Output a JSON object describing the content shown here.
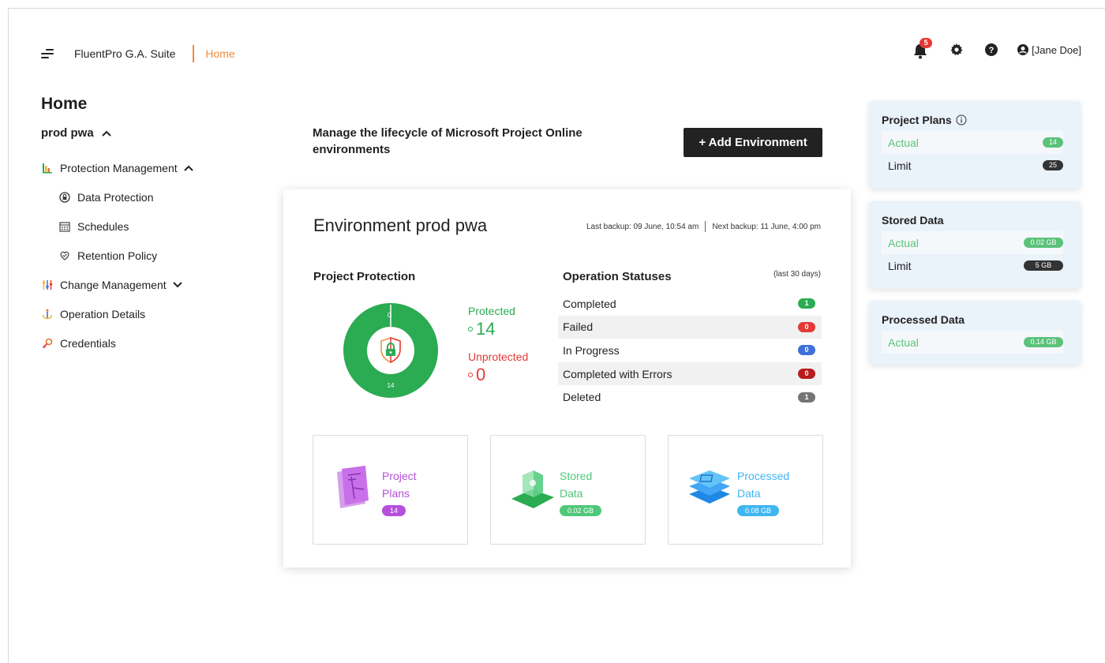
{
  "header": {
    "brand": "FluentPro G.A. Suite",
    "breadcrumb": "Home",
    "notifications_count": "5",
    "user_name": "[Jane Doe]"
  },
  "sidebar": {
    "title": "Home",
    "environment": "prod pwa",
    "items": [
      {
        "label": "Protection Management",
        "icon": "chart-icon"
      },
      {
        "label": "Data Protection",
        "icon": "lock-icon"
      },
      {
        "label": "Schedules",
        "icon": "calendar-icon"
      },
      {
        "label": "Retention Policy",
        "icon": "retention-icon"
      },
      {
        "label": "Change Management",
        "icon": "sliders-icon"
      },
      {
        "label": "Operation Details",
        "icon": "anchor-icon"
      },
      {
        "label": "Credentials",
        "icon": "key-icon"
      }
    ]
  },
  "main": {
    "manage_text": "Manage the lifecycle of Microsoft Project Online environments",
    "add_button": "+ Add Environment"
  },
  "environment": {
    "title": "Environment prod pwa",
    "last_backup": "Last backup: 09 June, 10:54 am",
    "next_backup": "Next backup: 11 June, 4:00 pm",
    "protection": {
      "title": "Project Protection",
      "protected_label": "Protected",
      "protected_value": "14",
      "unprotected_label": "Unprotected",
      "unprotected_value": "0",
      "donut_top_label": "0",
      "donut_bottom_label": "14",
      "protected_fraction": 1.0
    },
    "operations": {
      "title": "Operation Statuses",
      "period": "(last 30 days)",
      "rows": [
        {
          "label": "Completed",
          "count": "1",
          "color": "#2bab52"
        },
        {
          "label": "Failed",
          "count": "0",
          "color": "#e53935"
        },
        {
          "label": "In Progress",
          "count": "0",
          "color": "#3f6fd8"
        },
        {
          "label": "Completed with Errors",
          "count": "0",
          "color": "#b71c1c"
        },
        {
          "label": "Deleted",
          "count": "1",
          "color": "#757575"
        }
      ]
    },
    "tiles": [
      {
        "line1": "Project",
        "line2": "Plans",
        "value": "14",
        "color": "#b64fdb"
      },
      {
        "line1": "Stored",
        "line2": "Data",
        "value": "0.02 GB",
        "color": "#4fc879"
      },
      {
        "line1": "Processed",
        "line2": "Data",
        "value": "0.08 GB",
        "color": "#3fb6f0"
      }
    ]
  },
  "usage": {
    "project_plans": {
      "title": "Project Plans",
      "actual_label": "Actual",
      "actual": "14",
      "limit_label": "Limit",
      "limit": "25"
    },
    "stored_data": {
      "title": "Stored Data",
      "actual_label": "Actual",
      "actual": "0.02 GB",
      "limit_label": "Limit",
      "limit": "5 GB"
    },
    "processed_data": {
      "title": "Processed Data",
      "actual_label": "Actual",
      "actual": "0.14 GB"
    }
  },
  "colors": {
    "accent_orange": "#f08a3c",
    "green": "#2bab52",
    "actual_green": "#5bc27a",
    "dark_pill": "#333333"
  }
}
